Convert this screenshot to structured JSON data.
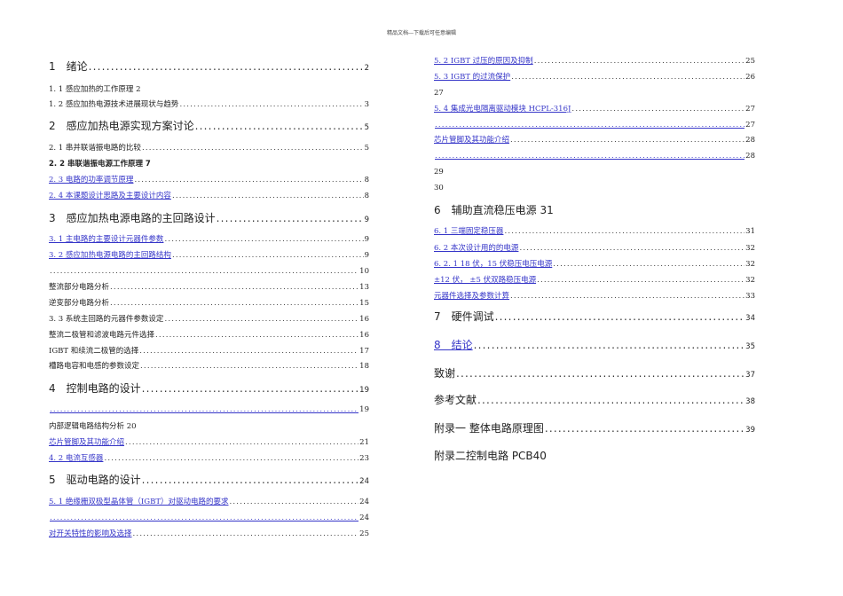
{
  "header": "精品文档---下载后可任意编辑",
  "left": [
    {
      "t": "1　绪论",
      "p": "2",
      "k": "h1"
    },
    {
      "t": "1. 1  感应加热的工作原理 2",
      "p": "",
      "k": "inline"
    },
    {
      "t": "1. 2  感应加热电源技术进展现状与趋势",
      "p": "3"
    },
    {
      "t": "2　感应加热电源实现方案讨论",
      "p": "5",
      "k": "h1"
    },
    {
      "t": "2. 1  串并联谐振电路的比较",
      "p": "5"
    },
    {
      "t": "2. 2  串联谐振电源工作原理 7",
      "p": "",
      "k": "inline bold"
    },
    {
      "t": "2. 3  电路的功率调节原理",
      "p": "8",
      "l": 1
    },
    {
      "t": "2. 4  本课题设计思路及主要设计内容",
      "p": "8",
      "l": 1
    },
    {
      "t": "3　感应加热电源电路的主回路设计",
      "p": "9",
      "k": "h1"
    },
    {
      "t": "3. 1  主电路的主要设计元器件参数",
      "p": "9",
      "l": 1
    },
    {
      "t": "3. 2  感应加热电源电路的主回路结构",
      "p": "9",
      "l": 1
    },
    {
      "t": "",
      "p": "10"
    },
    {
      "t": "整流部分电路分析",
      "p": "13"
    },
    {
      "t": "逆变部分电路分析",
      "p": "15"
    },
    {
      "t": "3. 3  系统主回路的元器件参数设定",
      "p": "16"
    },
    {
      "t": "整流二极管和滤波电路元件选择",
      "p": "16"
    },
    {
      "t": "IGBT 和续流二极管的选择",
      "p": "17"
    },
    {
      "t": "槽路电容和电感的参数设定",
      "p": "18"
    },
    {
      "t": "4　控制电路的设计",
      "p": "19",
      "k": "h1"
    },
    {
      "t": "",
      "p": "19",
      "l": 1,
      "u": 1
    },
    {
      "t": "内部逻辑电路结构分析 20",
      "p": "",
      "k": "inline"
    },
    {
      "t": "芯片管脚及其功能介绍",
      "p": "21",
      "l": 1
    },
    {
      "t": "4. 2  电流互感器",
      "p": "23",
      "l": 1
    },
    {
      "t": "5　驱动电路的设计",
      "p": "24",
      "k": "h1"
    },
    {
      "t": "5. 1  绝缘栅双极型晶体管（IGBT）对驱动电路的要求",
      "p": "24",
      "l": 1
    },
    {
      "t": "",
      "p": "24",
      "l": 1,
      "u": 1
    },
    {
      "t": "对开关特性的影响及选择",
      "p": "25",
      "l": 1
    }
  ],
  "right": [
    {
      "t": "5. 2  IGBT 过压的原因及抑制",
      "p": "25",
      "l": 1
    },
    {
      "t": "5. 3  IGBT 的过流保护",
      "p": "26",
      "l": 1
    },
    {
      "t": "27",
      "p": "",
      "k": "inline"
    },
    {
      "t": "5. 4 集成光电隔离驱动模块 HCPL-316J",
      "p": "27",
      "l": 1
    },
    {
      "t": "",
      "p": "27",
      "l": 1,
      "u": 1
    },
    {
      "t": "芯片管脚及其功能介绍",
      "p": "28",
      "l": 1
    },
    {
      "t": "",
      "p": "28",
      "l": 1,
      "u": 1
    },
    {
      "t": "29",
      "p": "",
      "k": "inline"
    },
    {
      "t": "30",
      "p": "",
      "k": "inline"
    },
    {
      "t": "6　辅助直流稳压电源 31",
      "p": "",
      "k": "h1 inline"
    },
    {
      "t": "6. 1  三端固定稳压器",
      "p": "31",
      "l": 1
    },
    {
      "t": "6. 2  本次设计用的的电源",
      "p": "32",
      "l": 1
    },
    {
      "t": "6. 2. 1  18 伏，15 伏稳压电压电源",
      "p": "32",
      "l": 1
    },
    {
      "t": "±12 伏， ±5 伏双路稳压电源",
      "p": "32",
      "l": 1
    },
    {
      "t": "元器件选择及参数计算",
      "p": "33",
      "l": 1
    },
    {
      "t": "7　硬件调试",
      "p": "34",
      "k": "h1"
    },
    {
      "t": "8　结论",
      "p": "35",
      "k": "h1",
      "l": 1
    },
    {
      "t": "致谢",
      "p": "37",
      "k": "h1"
    },
    {
      "t": "参考文献",
      "p": "38",
      "k": "h1"
    },
    {
      "t": "附录一  整体电路原理图",
      "p": "39",
      "k": "h1"
    },
    {
      "t": "附录二控制电路 PCB40",
      "p": "",
      "k": "h1 inline"
    }
  ]
}
